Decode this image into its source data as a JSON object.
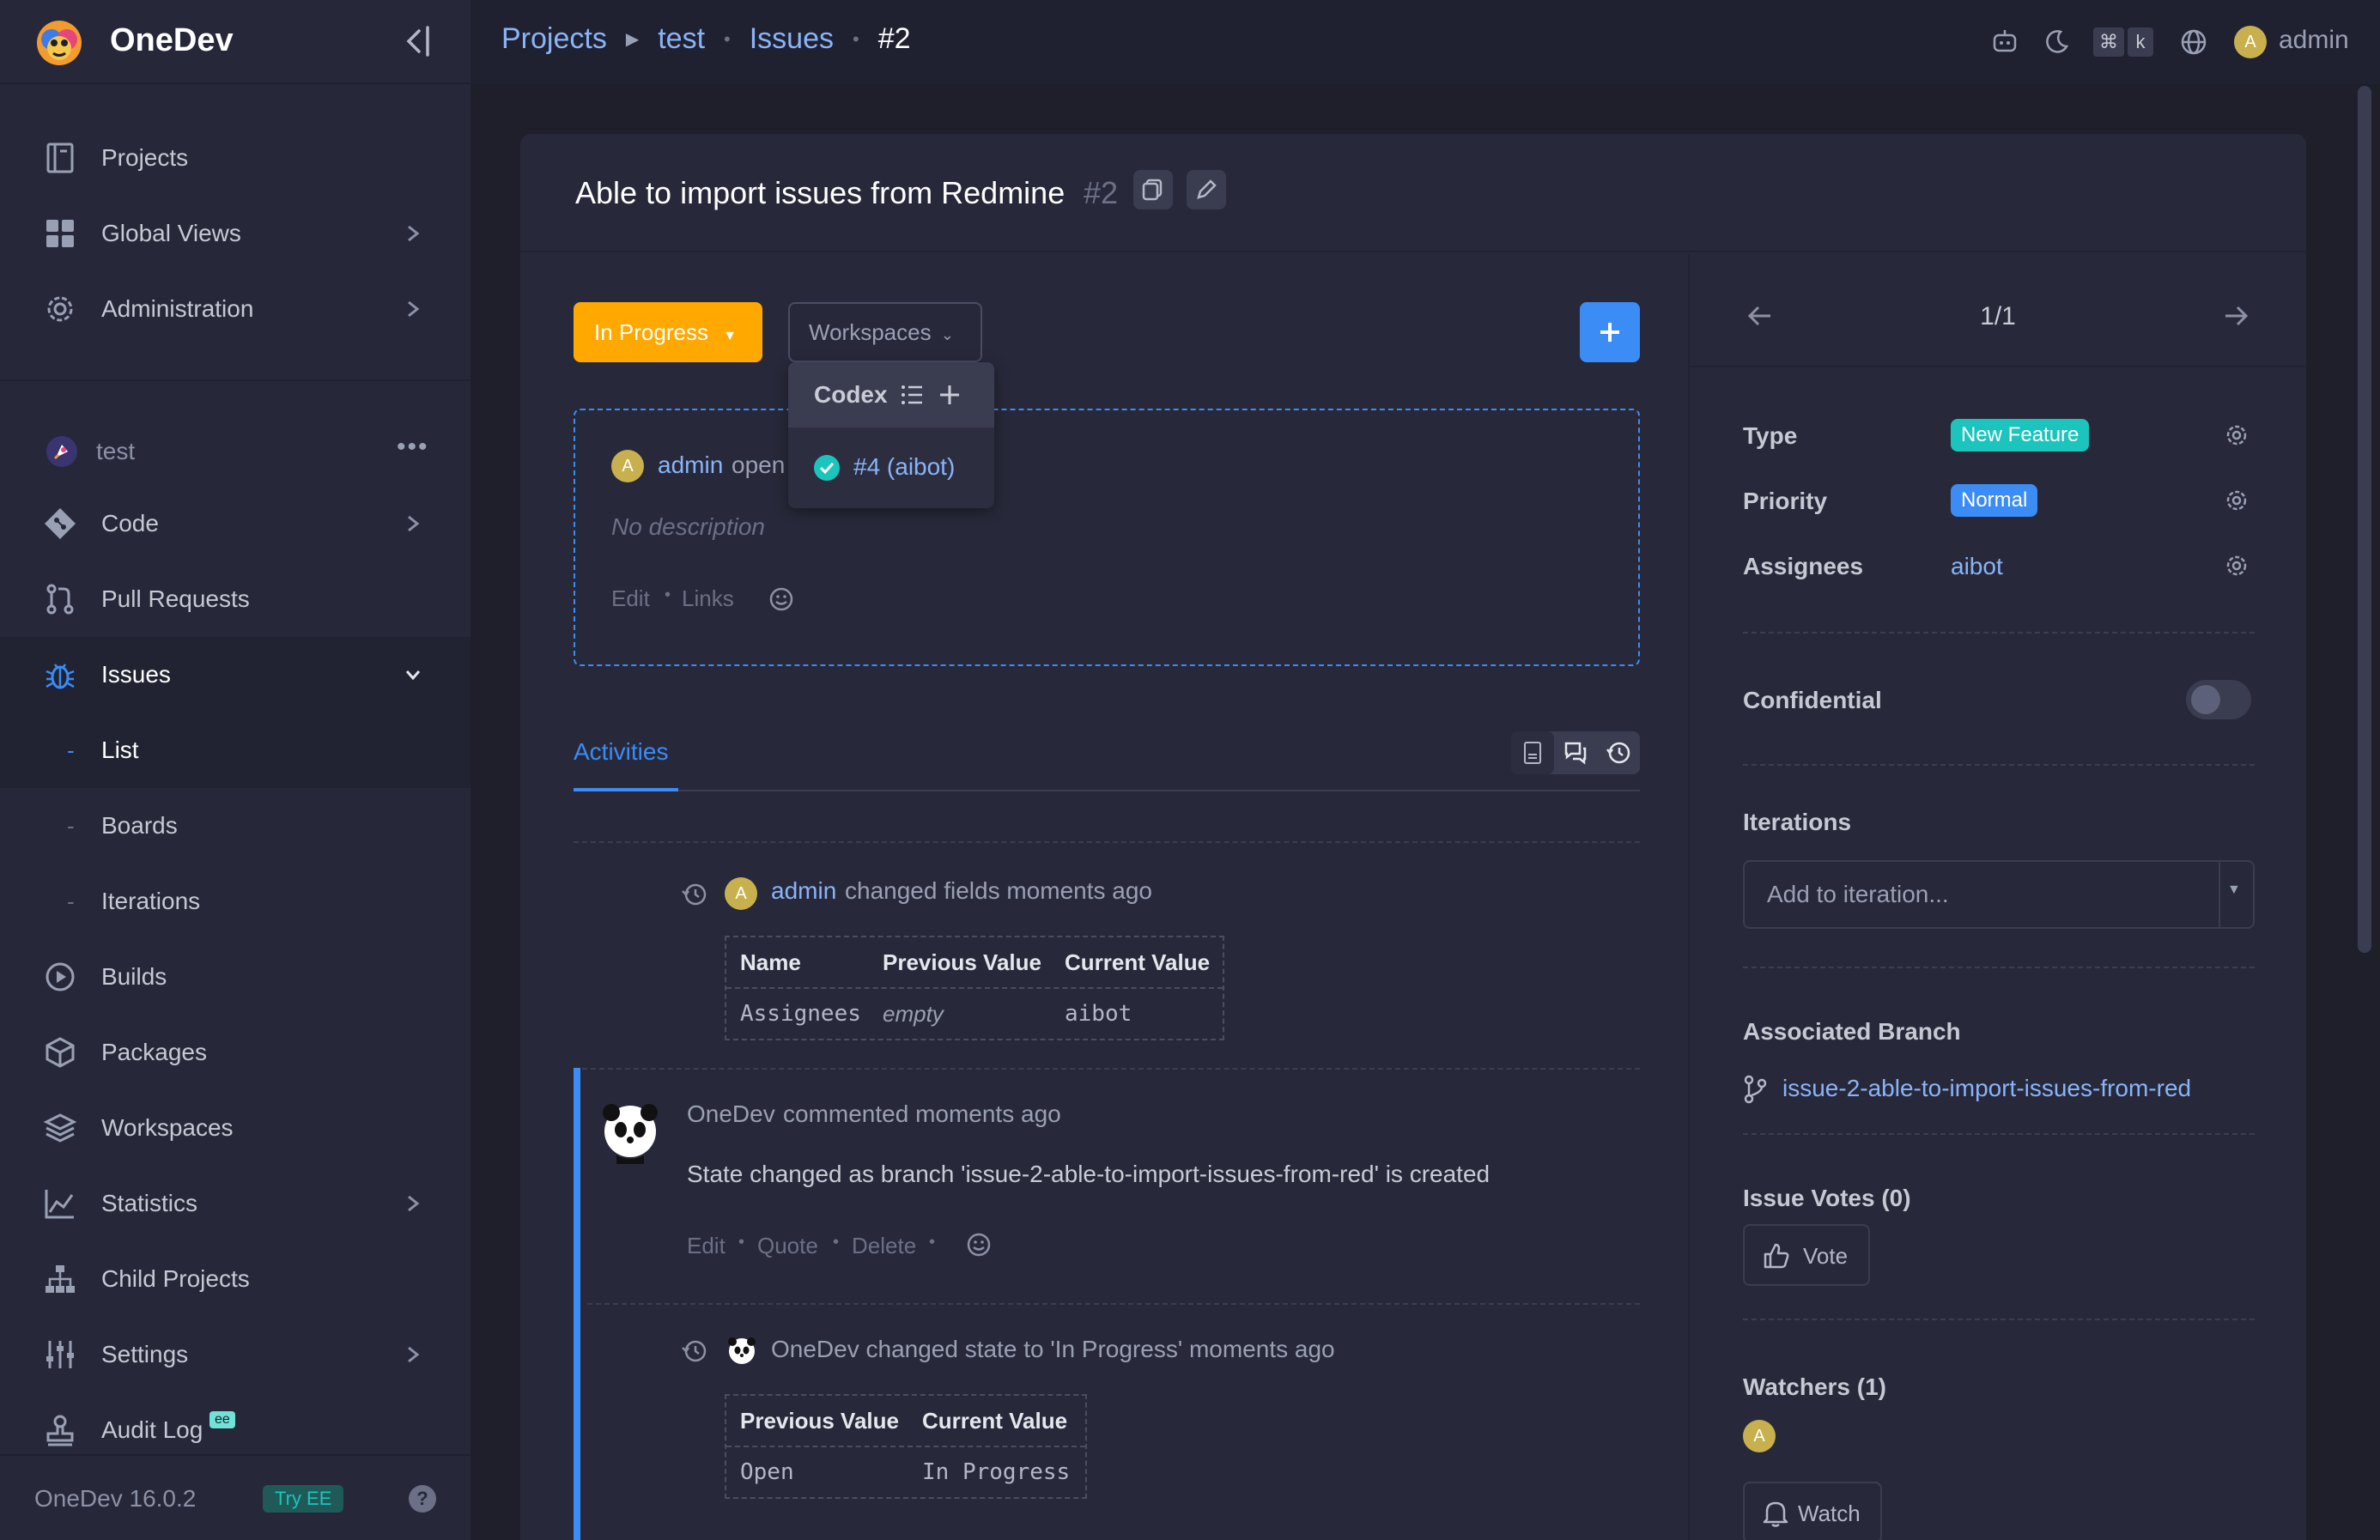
{
  "app": {
    "name": "OneDev"
  },
  "sidebar": {
    "top_items": [
      {
        "label": "Projects",
        "icon": "projects-icon"
      },
      {
        "label": "Global Views",
        "icon": "grid-icon"
      },
      {
        "label": "Administration",
        "icon": "gear-icon"
      }
    ],
    "project_name": "test",
    "project_items": [
      {
        "label": "Code",
        "icon": "code-icon"
      },
      {
        "label": "Pull Requests",
        "icon": "pull-request-icon"
      },
      {
        "label": "Issues",
        "icon": "bug-icon"
      },
      {
        "label": "List"
      },
      {
        "label": "Boards"
      },
      {
        "label": "Iterations"
      },
      {
        "label": "Builds",
        "icon": "play-icon"
      },
      {
        "label": "Packages",
        "icon": "package-icon"
      },
      {
        "label": "Workspaces",
        "icon": "layers-icon"
      },
      {
        "label": "Statistics",
        "icon": "chart-icon"
      },
      {
        "label": "Child Projects",
        "icon": "hierarchy-icon"
      },
      {
        "label": "Settings",
        "icon": "sliders-icon"
      },
      {
        "label": "Audit Log",
        "icon": "stamp-icon",
        "badge": "ee"
      }
    ],
    "version": "OneDev 16.0.2",
    "try_ee": "Try EE",
    "help": "?"
  },
  "topbar": {
    "breadcrumb": [
      "Projects",
      "test",
      "Issues",
      "#2"
    ],
    "user": "admin",
    "avatar_letter": "A",
    "kbd": [
      "⌘",
      "k"
    ]
  },
  "issue": {
    "title": "Able to import issues from Redmine",
    "number": "#2",
    "state_button": "In Progress",
    "workspaces_button": "Workspaces",
    "workspace_menu": {
      "header": "Codex",
      "item": "#4 (aibot)"
    },
    "author": "admin",
    "opened": "open",
    "description": "No description",
    "actions": [
      "Edit",
      "Links"
    ]
  },
  "activities": {
    "tab": "Activities",
    "change1": {
      "user": "admin",
      "text": "changed fields moments ago",
      "headers": [
        "Name",
        "Previous Value",
        "Current Value"
      ],
      "row": [
        "Assignees",
        "empty",
        "aibot"
      ]
    },
    "comment": {
      "author": "OneDev",
      "meta": "commented moments ago",
      "body": "State changed as branch 'issue-2-able-to-import-issues-from-red' is created",
      "actions": [
        "Edit",
        "Quote",
        "Delete"
      ]
    },
    "change2": {
      "text": "OneDev changed state to 'In Progress' moments ago",
      "headers": [
        "Previous Value",
        "Current Value"
      ],
      "row": [
        "Open",
        "In Progress"
      ]
    }
  },
  "side": {
    "pager": "1/1",
    "type_label": "Type",
    "type_value": "New Feature",
    "priority_label": "Priority",
    "priority_value": "Normal",
    "assignees_label": "Assignees",
    "assignees_value": "aibot",
    "confidential_label": "Confidential",
    "iterations_label": "Iterations",
    "iterations_placeholder": "Add to iteration...",
    "branch_label": "Associated Branch",
    "branch_value": "issue-2-able-to-import-issues-from-red",
    "votes_label": "Issue Votes (0)",
    "vote_button": "Vote",
    "watchers_label": "Watchers (1)",
    "watch_button": "Watch"
  },
  "colors": {
    "accent": "#3b8cf4",
    "state": "#ffa800",
    "new_feature": "#1bc5bd",
    "normal": "#3b8cf4",
    "avatar": "#c9b04f"
  }
}
